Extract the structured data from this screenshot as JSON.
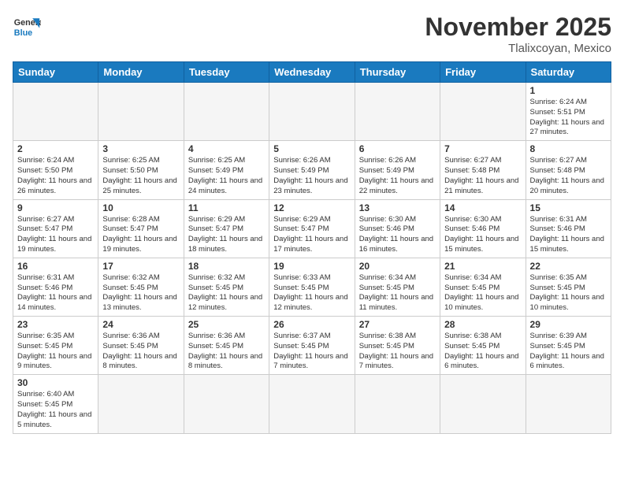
{
  "header": {
    "logo_general": "General",
    "logo_blue": "Blue",
    "month_year": "November 2025",
    "location": "Tlalixcoyan, Mexico"
  },
  "weekdays": [
    "Sunday",
    "Monday",
    "Tuesday",
    "Wednesday",
    "Thursday",
    "Friday",
    "Saturday"
  ],
  "weeks": [
    [
      {
        "day": "",
        "info": ""
      },
      {
        "day": "",
        "info": ""
      },
      {
        "day": "",
        "info": ""
      },
      {
        "day": "",
        "info": ""
      },
      {
        "day": "",
        "info": ""
      },
      {
        "day": "",
        "info": ""
      },
      {
        "day": "1",
        "info": "Sunrise: 6:24 AM\nSunset: 5:51 PM\nDaylight: 11 hours and 27 minutes."
      }
    ],
    [
      {
        "day": "2",
        "info": "Sunrise: 6:24 AM\nSunset: 5:50 PM\nDaylight: 11 hours and 26 minutes."
      },
      {
        "day": "3",
        "info": "Sunrise: 6:25 AM\nSunset: 5:50 PM\nDaylight: 11 hours and 25 minutes."
      },
      {
        "day": "4",
        "info": "Sunrise: 6:25 AM\nSunset: 5:49 PM\nDaylight: 11 hours and 24 minutes."
      },
      {
        "day": "5",
        "info": "Sunrise: 6:26 AM\nSunset: 5:49 PM\nDaylight: 11 hours and 23 minutes."
      },
      {
        "day": "6",
        "info": "Sunrise: 6:26 AM\nSunset: 5:49 PM\nDaylight: 11 hours and 22 minutes."
      },
      {
        "day": "7",
        "info": "Sunrise: 6:27 AM\nSunset: 5:48 PM\nDaylight: 11 hours and 21 minutes."
      },
      {
        "day": "8",
        "info": "Sunrise: 6:27 AM\nSunset: 5:48 PM\nDaylight: 11 hours and 20 minutes."
      }
    ],
    [
      {
        "day": "9",
        "info": "Sunrise: 6:27 AM\nSunset: 5:47 PM\nDaylight: 11 hours and 19 minutes."
      },
      {
        "day": "10",
        "info": "Sunrise: 6:28 AM\nSunset: 5:47 PM\nDaylight: 11 hours and 19 minutes."
      },
      {
        "day": "11",
        "info": "Sunrise: 6:29 AM\nSunset: 5:47 PM\nDaylight: 11 hours and 18 minutes."
      },
      {
        "day": "12",
        "info": "Sunrise: 6:29 AM\nSunset: 5:47 PM\nDaylight: 11 hours and 17 minutes."
      },
      {
        "day": "13",
        "info": "Sunrise: 6:30 AM\nSunset: 5:46 PM\nDaylight: 11 hours and 16 minutes."
      },
      {
        "day": "14",
        "info": "Sunrise: 6:30 AM\nSunset: 5:46 PM\nDaylight: 11 hours and 15 minutes."
      },
      {
        "day": "15",
        "info": "Sunrise: 6:31 AM\nSunset: 5:46 PM\nDaylight: 11 hours and 15 minutes."
      }
    ],
    [
      {
        "day": "16",
        "info": "Sunrise: 6:31 AM\nSunset: 5:46 PM\nDaylight: 11 hours and 14 minutes."
      },
      {
        "day": "17",
        "info": "Sunrise: 6:32 AM\nSunset: 5:45 PM\nDaylight: 11 hours and 13 minutes."
      },
      {
        "day": "18",
        "info": "Sunrise: 6:32 AM\nSunset: 5:45 PM\nDaylight: 11 hours and 12 minutes."
      },
      {
        "day": "19",
        "info": "Sunrise: 6:33 AM\nSunset: 5:45 PM\nDaylight: 11 hours and 12 minutes."
      },
      {
        "day": "20",
        "info": "Sunrise: 6:34 AM\nSunset: 5:45 PM\nDaylight: 11 hours and 11 minutes."
      },
      {
        "day": "21",
        "info": "Sunrise: 6:34 AM\nSunset: 5:45 PM\nDaylight: 11 hours and 10 minutes."
      },
      {
        "day": "22",
        "info": "Sunrise: 6:35 AM\nSunset: 5:45 PM\nDaylight: 11 hours and 10 minutes."
      }
    ],
    [
      {
        "day": "23",
        "info": "Sunrise: 6:35 AM\nSunset: 5:45 PM\nDaylight: 11 hours and 9 minutes."
      },
      {
        "day": "24",
        "info": "Sunrise: 6:36 AM\nSunset: 5:45 PM\nDaylight: 11 hours and 8 minutes."
      },
      {
        "day": "25",
        "info": "Sunrise: 6:36 AM\nSunset: 5:45 PM\nDaylight: 11 hours and 8 minutes."
      },
      {
        "day": "26",
        "info": "Sunrise: 6:37 AM\nSunset: 5:45 PM\nDaylight: 11 hours and 7 minutes."
      },
      {
        "day": "27",
        "info": "Sunrise: 6:38 AM\nSunset: 5:45 PM\nDaylight: 11 hours and 7 minutes."
      },
      {
        "day": "28",
        "info": "Sunrise: 6:38 AM\nSunset: 5:45 PM\nDaylight: 11 hours and 6 minutes."
      },
      {
        "day": "29",
        "info": "Sunrise: 6:39 AM\nSunset: 5:45 PM\nDaylight: 11 hours and 6 minutes."
      }
    ],
    [
      {
        "day": "30",
        "info": "Sunrise: 6:40 AM\nSunset: 5:45 PM\nDaylight: 11 hours and 5 minutes."
      },
      {
        "day": "",
        "info": ""
      },
      {
        "day": "",
        "info": ""
      },
      {
        "day": "",
        "info": ""
      },
      {
        "day": "",
        "info": ""
      },
      {
        "day": "",
        "info": ""
      },
      {
        "day": "",
        "info": ""
      }
    ]
  ]
}
